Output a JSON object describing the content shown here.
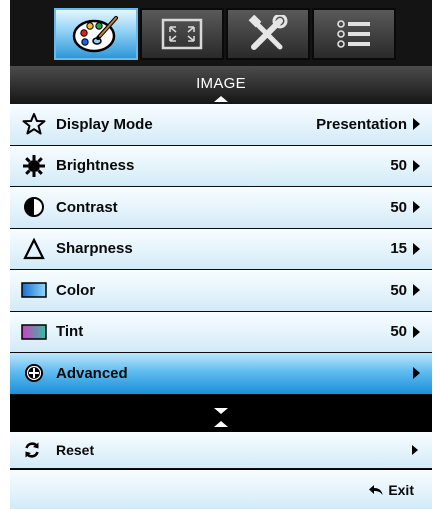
{
  "tabs": [
    {
      "icon": "palette-icon",
      "active": true
    },
    {
      "icon": "screen-frame-icon",
      "active": false
    },
    {
      "icon": "tools-icon",
      "active": false
    },
    {
      "icon": "list-icon",
      "active": false
    }
  ],
  "menu": {
    "title": "IMAGE",
    "items": [
      {
        "label": "Display Mode",
        "value": "Presentation",
        "icon": "star-icon"
      },
      {
        "label": "Brightness",
        "value": "50",
        "icon": "sun-icon"
      },
      {
        "label": "Contrast",
        "value": "50",
        "icon": "contrast-icon"
      },
      {
        "label": "Sharpness",
        "value": "15",
        "icon": "delta-icon"
      },
      {
        "label": "Color",
        "value": "50",
        "icon": "color-swatch-icon"
      },
      {
        "label": "Tint",
        "value": "50",
        "icon": "tint-swatch-icon"
      },
      {
        "label": "Advanced",
        "value": "",
        "icon": "plus-circle-icon",
        "selected": true
      }
    ]
  },
  "reset": {
    "label": "Reset",
    "icon": "refresh-icon"
  },
  "exit": {
    "label": "Exit",
    "icon": "return-arrow-icon"
  },
  "colors": {
    "row_background": "#e4f3fb",
    "selected_row": "#4fb3ee",
    "active_tab": "#8fd0f5",
    "inactive_tab": "#3c3c3c",
    "frame": "#000000"
  }
}
